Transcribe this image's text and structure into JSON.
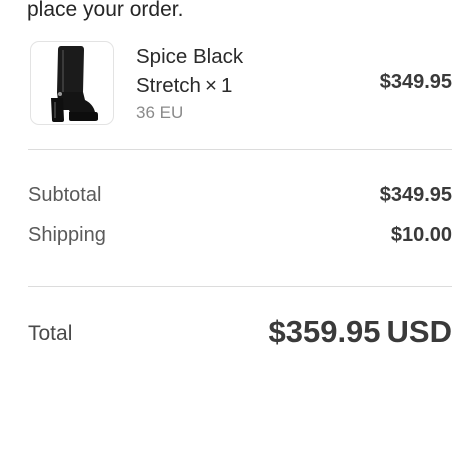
{
  "intro": {
    "text": "place your order."
  },
  "cart": {
    "items": [
      {
        "name_line1": "Spice Black",
        "name_line2": "Stretch",
        "quantity_prefix": "×",
        "quantity": "1",
        "variant": "36 EU",
        "price": "$349.95",
        "image_icon": "black-platform-boot"
      }
    ]
  },
  "summary": {
    "subtotal_label": "Subtotal",
    "subtotal_value": "$349.95",
    "shipping_label": "Shipping",
    "shipping_value": "$10.00"
  },
  "total": {
    "label": "Total",
    "amount": "$359.95",
    "currency": "USD"
  }
}
